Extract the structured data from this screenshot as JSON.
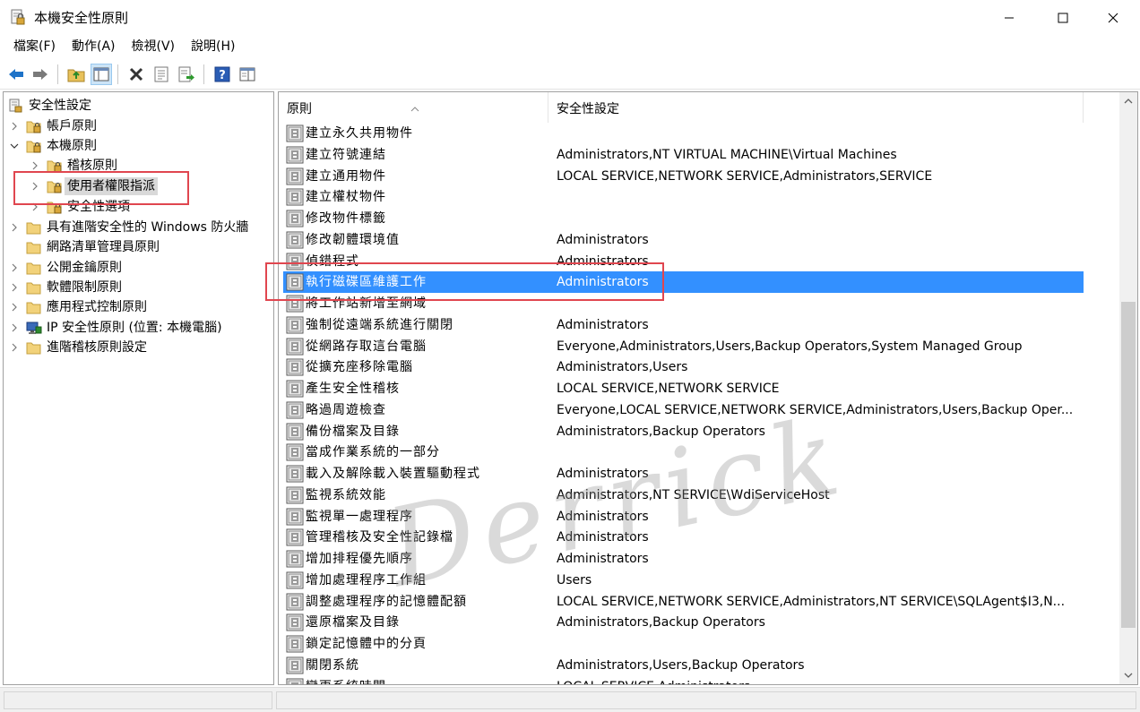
{
  "window": {
    "title": "本機安全性原則"
  },
  "menu": [
    "檔案(F)",
    "動作(A)",
    "檢視(V)",
    "說明(H)"
  ],
  "toolbar": {
    "icons": [
      "back-arrow-icon",
      "forward-arrow-icon",
      "up-folder-icon",
      "show-tree-icon",
      "delete-icon",
      "properties-icon",
      "export-list-icon",
      "help-icon",
      "console-icon"
    ]
  },
  "tree": {
    "items": [
      {
        "label": "安全性設定",
        "icon": "security-root-icon",
        "expanded": true
      },
      {
        "label": "帳戶原則",
        "icon": "folder-lock-icon"
      },
      {
        "label": "本機原則",
        "icon": "folder-lock-icon",
        "expanded": true
      },
      {
        "label": "稽核原則",
        "icon": "folder-lock-icon"
      },
      {
        "label": "使用者權限指派",
        "icon": "folder-lock-icon",
        "selected": true
      },
      {
        "label": "安全性選項",
        "icon": "folder-lock-icon"
      },
      {
        "label": "具有進階安全性的 Windows 防火牆",
        "icon": "folder-icon"
      },
      {
        "label": "網路清單管理員原則",
        "icon": "folder-icon"
      },
      {
        "label": "公開金鑰原則",
        "icon": "folder-icon"
      },
      {
        "label": "軟體限制原則",
        "icon": "folder-icon"
      },
      {
        "label": "應用程式控制原則",
        "icon": "folder-icon"
      },
      {
        "label": "IP 安全性原則 (位置: 本機電腦)",
        "icon": "ip-security-icon"
      },
      {
        "label": "進階稽核原則設定",
        "icon": "folder-icon"
      }
    ]
  },
  "list": {
    "col_policy": "原則",
    "col_setting": "安全性設定",
    "rows": [
      {
        "name": "建立永久共用物件",
        "value": ""
      },
      {
        "name": "建立符號連結",
        "value": "Administrators,NT VIRTUAL MACHINE\\Virtual Machines"
      },
      {
        "name": "建立通用物件",
        "value": "LOCAL SERVICE,NETWORK SERVICE,Administrators,SERVICE"
      },
      {
        "name": "建立權杖物件",
        "value": ""
      },
      {
        "name": "修改物件標籤",
        "value": ""
      },
      {
        "name": "修改韌體環境值",
        "value": "Administrators"
      },
      {
        "name": "偵錯程式",
        "value": "Administrators"
      },
      {
        "name": "執行磁碟區維護工作",
        "value": "Administrators",
        "selected": true
      },
      {
        "name": "將工作站新增至網域",
        "value": ""
      },
      {
        "name": "強制從遠端系統進行關閉",
        "value": "Administrators"
      },
      {
        "name": "從網路存取這台電腦",
        "value": "Everyone,Administrators,Users,Backup Operators,System Managed Group"
      },
      {
        "name": "從擴充座移除電腦",
        "value": "Administrators,Users"
      },
      {
        "name": "產生安全性稽核",
        "value": "LOCAL SERVICE,NETWORK SERVICE"
      },
      {
        "name": "略過周遊檢查",
        "value": "Everyone,LOCAL SERVICE,NETWORK SERVICE,Administrators,Users,Backup Oper..."
      },
      {
        "name": "備份檔案及目錄",
        "value": "Administrators,Backup Operators"
      },
      {
        "name": "當成作業系統的一部分",
        "value": ""
      },
      {
        "name": "載入及解除載入裝置驅動程式",
        "value": "Administrators"
      },
      {
        "name": "監視系統效能",
        "value": "Administrators,NT SERVICE\\WdiServiceHost"
      },
      {
        "name": "監視單一處理程序",
        "value": "Administrators"
      },
      {
        "name": "管理稽核及安全性記錄檔",
        "value": "Administrators"
      },
      {
        "name": "增加排程優先順序",
        "value": "Administrators"
      },
      {
        "name": "增加處理程序工作組",
        "value": "Users"
      },
      {
        "name": "調整處理程序的記憶體配額",
        "value": "LOCAL SERVICE,NETWORK SERVICE,Administrators,NT SERVICE\\SQLAgent$I3,N..."
      },
      {
        "name": "還原檔案及目錄",
        "value": "Administrators,Backup Operators"
      },
      {
        "name": "鎖定記憶體中的分頁",
        "value": ""
      },
      {
        "name": "關閉系統",
        "value": "Administrators,Users,Backup Operators"
      },
      {
        "name": "變更系統時間",
        "value": "LOCAL SERVICE,Administrators"
      }
    ]
  },
  "watermark": "Derrick",
  "colors": {
    "selection": "#3390ff",
    "annotation": "#e0464f",
    "tree_selection": "#d9d9d9"
  }
}
